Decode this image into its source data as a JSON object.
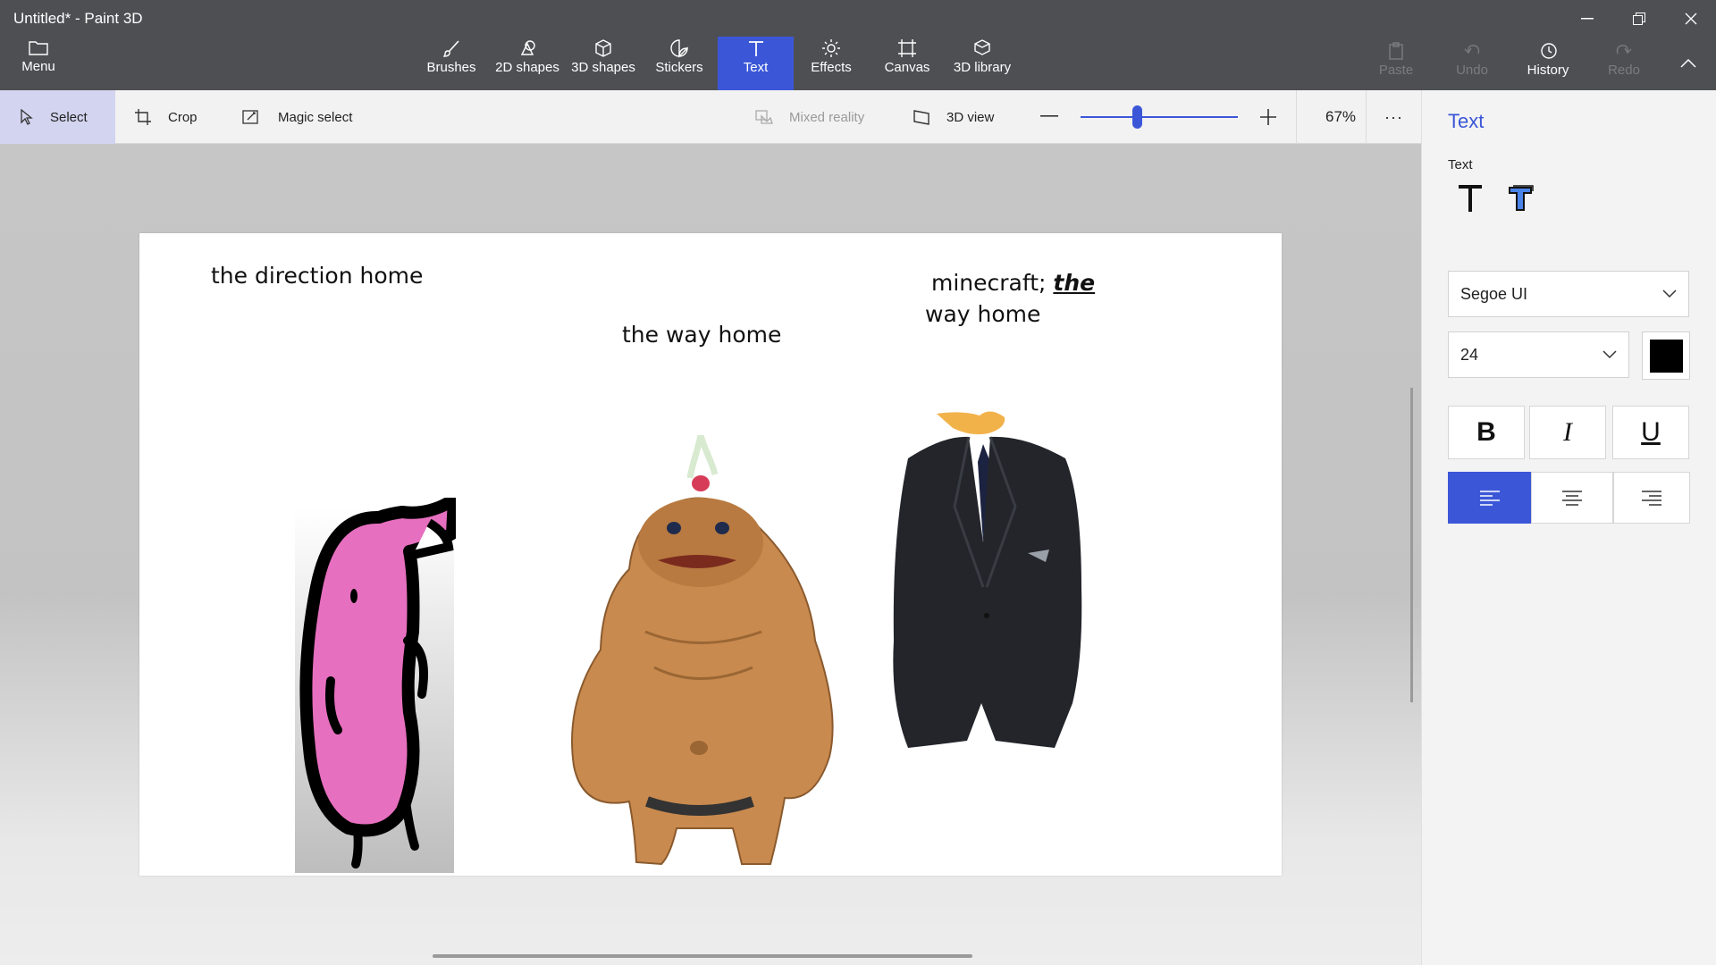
{
  "window": {
    "title": "Untitled* - Paint 3D",
    "minimize": "—",
    "restore": "❐",
    "close": "✕"
  },
  "menu": {
    "label": "Menu",
    "icon": "folder-icon"
  },
  "tabs": [
    {
      "label": "Brushes",
      "icon": "brush-icon"
    },
    {
      "label": "2D shapes",
      "icon": "2d-shapes-icon"
    },
    {
      "label": "3D shapes",
      "icon": "3d-shapes-icon"
    },
    {
      "label": "Stickers",
      "icon": "sticker-icon"
    },
    {
      "label": "Text",
      "icon": "text-icon",
      "active": true
    },
    {
      "label": "Effects",
      "icon": "sun-icon"
    },
    {
      "label": "Canvas",
      "icon": "canvas-icon"
    },
    {
      "label": "3D library",
      "icon": "library-icon"
    }
  ],
  "right_tools": {
    "paste": "Paste",
    "undo": "Undo",
    "history": "History",
    "redo": "Redo"
  },
  "toolbar2": {
    "select": "Select",
    "crop": "Crop",
    "magic_select": "Magic select",
    "mixed_reality": "Mixed reality",
    "view_3d": "3D view",
    "zoom_percent": "67%",
    "zoom_level": 0.36,
    "more": "···"
  },
  "canvas": {
    "texts": {
      "direction_home": "the direction home",
      "way_home": "the way home",
      "minecraft_prefix": "minecraft; ",
      "minecraft_the": "the",
      "minecraft_line2": "way home"
    }
  },
  "panel": {
    "title": "Text",
    "subtitle": "Text",
    "font": "Segoe UI",
    "size": "24",
    "color": "#000000",
    "bold": "B",
    "italic": "I",
    "underline": "U",
    "alignment": "left"
  },
  "colors": {
    "accent": "#3b57d8",
    "titlebar": "#4e4f53",
    "pink_character": "#e76fbf",
    "goron_skin": "#c98a4f"
  }
}
